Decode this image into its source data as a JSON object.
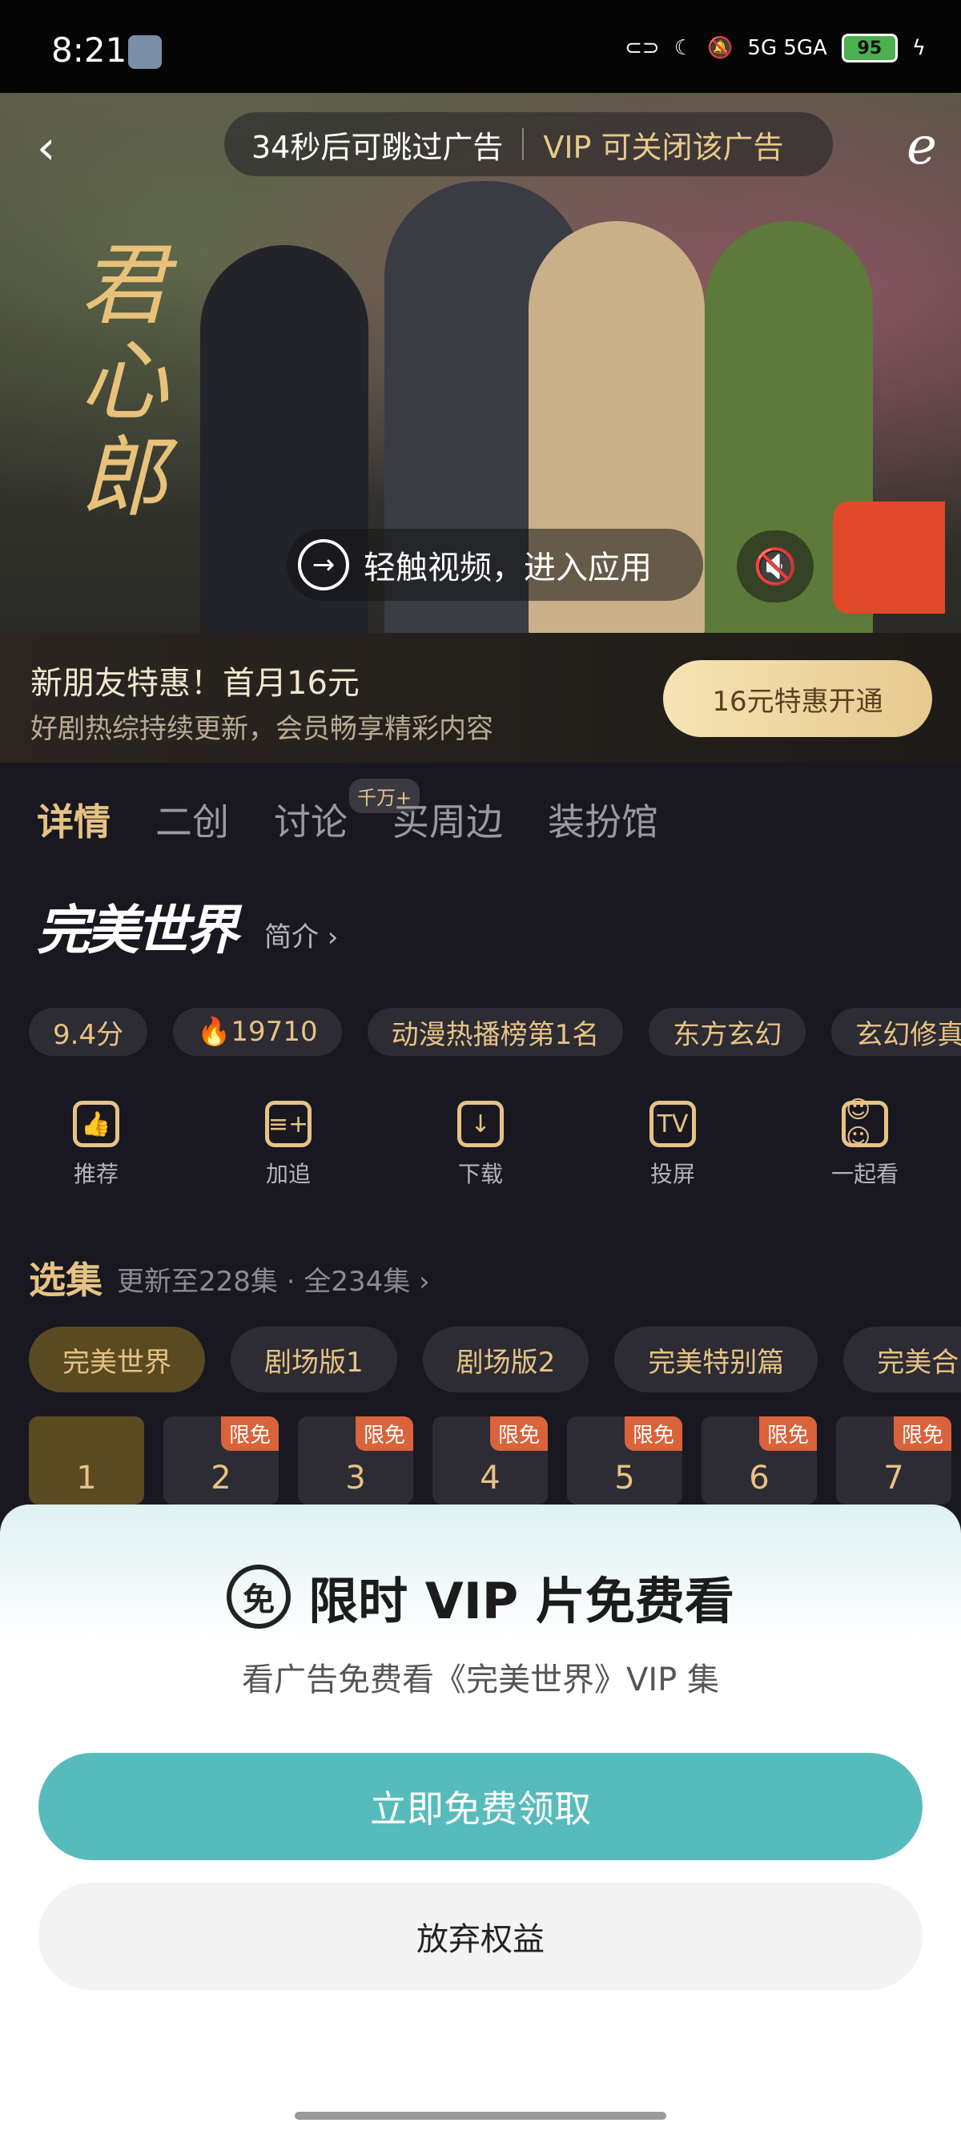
{
  "status_bar": {
    "time": "8:21",
    "battery": "95",
    "network": "5G  5GA"
  },
  "video": {
    "skip_text": "34秒后可跳过广告",
    "vip_close_text": "VIP 可关闭该广告",
    "drama_title": "君心郎",
    "enter_app_text": "轻触视频，进入应用"
  },
  "promo": {
    "title": "新朋友特惠！首月16元",
    "subtitle": "好剧热综持续更新，会员畅享精彩内容",
    "button": "16元特惠开通"
  },
  "tabs": [
    {
      "label": "详情"
    },
    {
      "label": "二创"
    },
    {
      "label": "讨论",
      "badge": "千万+"
    },
    {
      "label": "买周边"
    },
    {
      "label": "装扮馆"
    }
  ],
  "show": {
    "logo_text": "完美世界",
    "intro_link": "简介 ›"
  },
  "chips": [
    "9.4分",
    "🔥19710",
    "动漫热播榜第1名",
    "东方玄幻",
    "玄幻修真"
  ],
  "actions": [
    {
      "icon": "thumbs-up-icon",
      "label": "推荐"
    },
    {
      "icon": "add-to-list-icon",
      "label": "加追"
    },
    {
      "icon": "download-icon",
      "label": "下载"
    },
    {
      "icon": "tv-cast-icon",
      "label": "投屏"
    },
    {
      "icon": "watch-together-icon",
      "label": "一起看"
    }
  ],
  "episodes": {
    "section_title": "选集",
    "update_info": "更新至228集 · 全234集 ›",
    "seasons": [
      "完美世界",
      "剧场版1",
      "剧场版2",
      "完美特别篇",
      "完美合"
    ],
    "list": [
      {
        "num": "1",
        "tag": ""
      },
      {
        "num": "2",
        "tag": "限免"
      },
      {
        "num": "3",
        "tag": "限免"
      },
      {
        "num": "4",
        "tag": "限免"
      },
      {
        "num": "5",
        "tag": "限免"
      },
      {
        "num": "6",
        "tag": "限免"
      },
      {
        "num": "7",
        "tag": "限免"
      }
    ]
  },
  "sheet": {
    "icon_char": "免",
    "title": "限时 VIP 片免费看",
    "description": "看广告免费看《完美世界》VIP 集",
    "primary_button": "立即免费领取",
    "secondary_button": "放弃权益"
  }
}
